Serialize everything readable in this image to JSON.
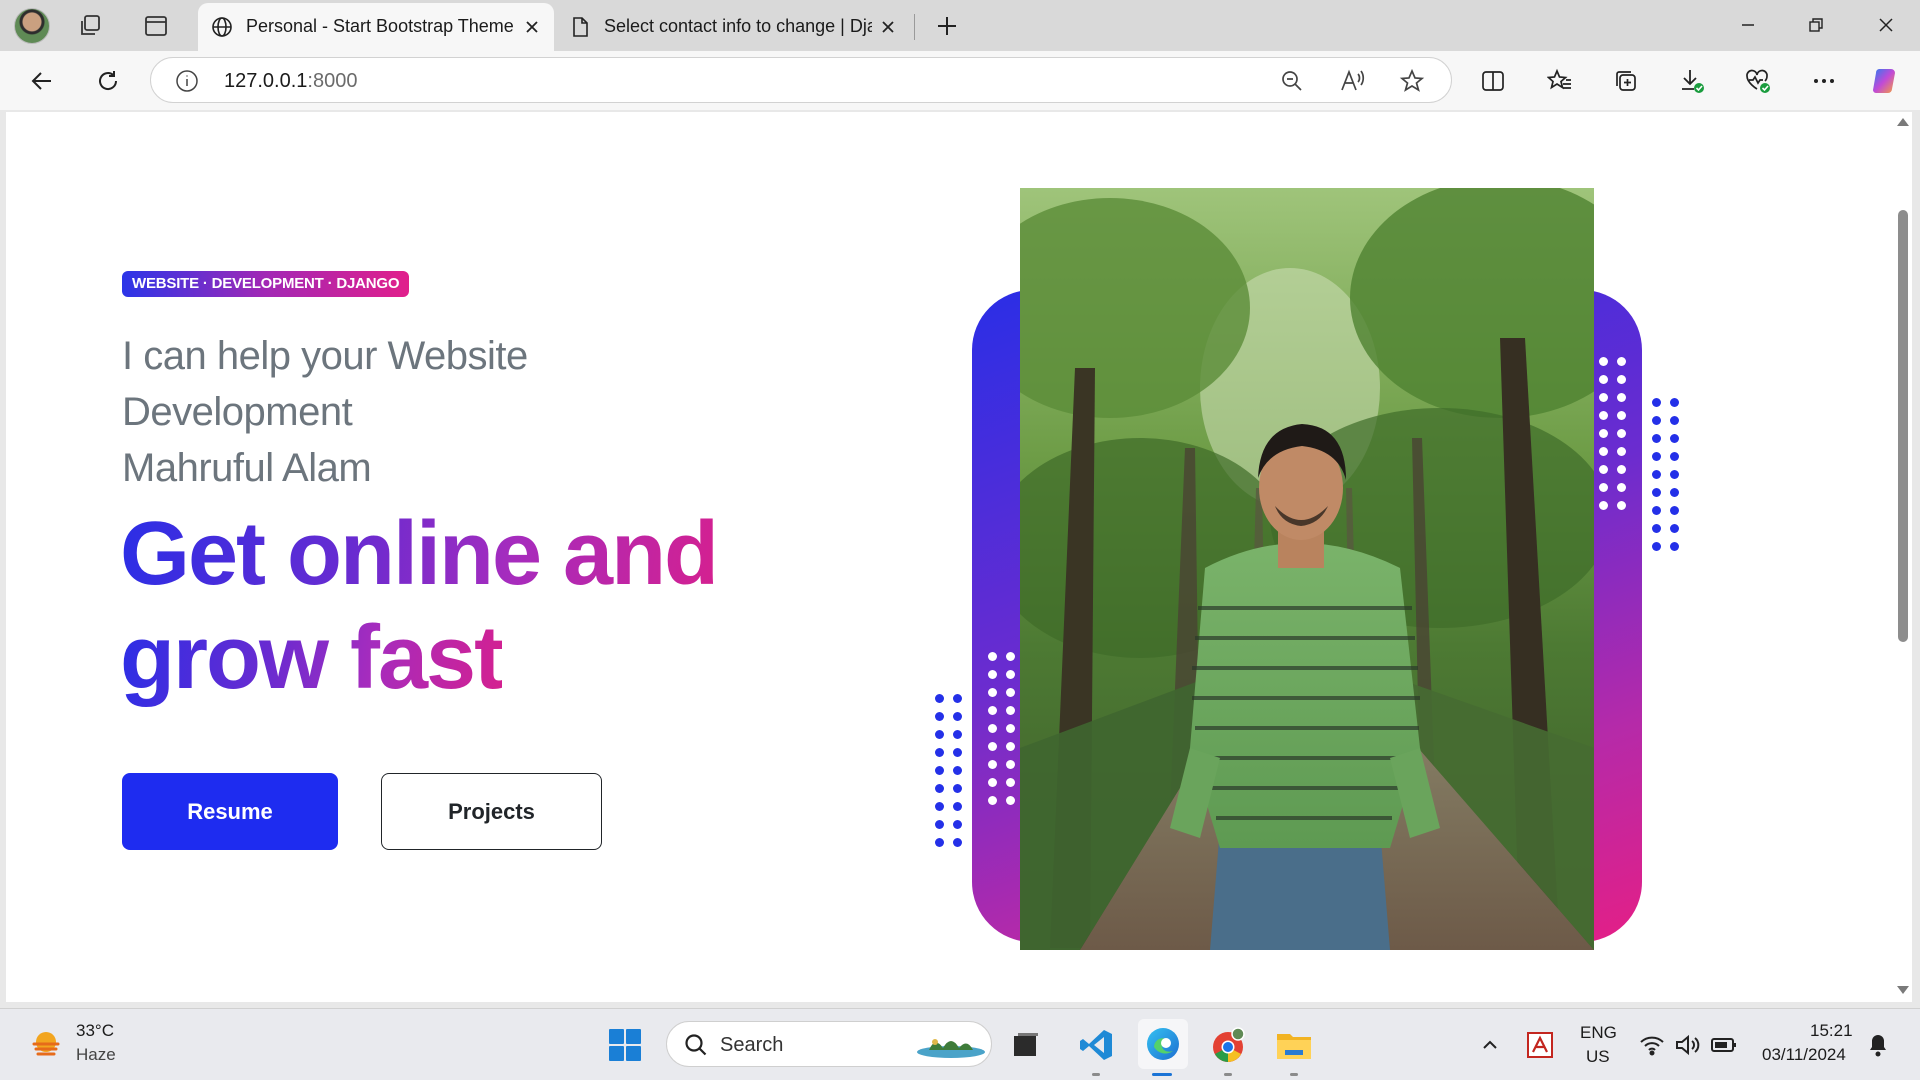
{
  "browser": {
    "tabs": [
      {
        "title": "Personal - Start Bootstrap Theme",
        "active": true
      },
      {
        "title": "Select contact info to change | Dja",
        "active": false
      }
    ],
    "address": {
      "host": "127.0.0.1",
      "port": ":8000"
    }
  },
  "page": {
    "badge": "WEBSITE · DEVELOPMENT · DJANGO",
    "lead_lines": [
      "I can help your Website",
      "Development",
      "Mahruful Alam"
    ],
    "headline_lines": [
      "Get online and",
      "grow fast"
    ],
    "buttons": {
      "resume": "Resume",
      "projects": "Projects"
    }
  },
  "taskbar": {
    "weather": {
      "temp": "33°C",
      "condition": "Haze"
    },
    "search_placeholder": "Search",
    "language": {
      "lang": "ENG",
      "region": "US"
    },
    "clock": {
      "time": "15:21",
      "date": "03/11/2024"
    }
  },
  "colors": {
    "accent_blue": "#1e2cf0",
    "gradient_start": "#2a2ee6",
    "gradient_mid": "#a52cbe",
    "gradient_end": "#e11f8b"
  }
}
